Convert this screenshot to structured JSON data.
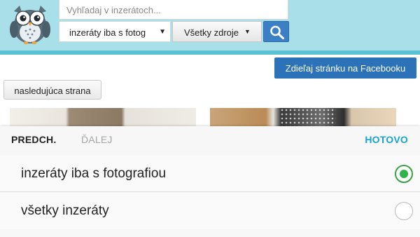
{
  "header": {
    "search": {
      "placeholder": "Vyhľadaj v inzerátoch..."
    },
    "filter_select": {
      "selected": "inzeráty iba s fotog",
      "icon": "caret-down-icon"
    },
    "source_button": {
      "label": "Všetky zdroje",
      "icon": "caret-down-icon"
    },
    "search_button": {
      "icon": "magnifier-icon"
    },
    "logo": {
      "icon": "owl-logo-icon"
    }
  },
  "share": {
    "facebook_label": "Zdieľaj stránku na Facebooku"
  },
  "pagination": {
    "next_label": "nasledujúca strana"
  },
  "picker": {
    "prev_label": "PREDCH.",
    "next_label": "ĎALEJ",
    "done_label": "HOTOVO",
    "options": [
      {
        "label": "inzeráty iba s fotografiou",
        "selected": true
      },
      {
        "label": "všetky inzeráty",
        "selected": false
      }
    ]
  },
  "colors": {
    "header_bg": "#a8dfe8",
    "accent_blue": "#2c72b8",
    "done_color": "#1aa3c9",
    "radio_selected": "#2db34a"
  }
}
